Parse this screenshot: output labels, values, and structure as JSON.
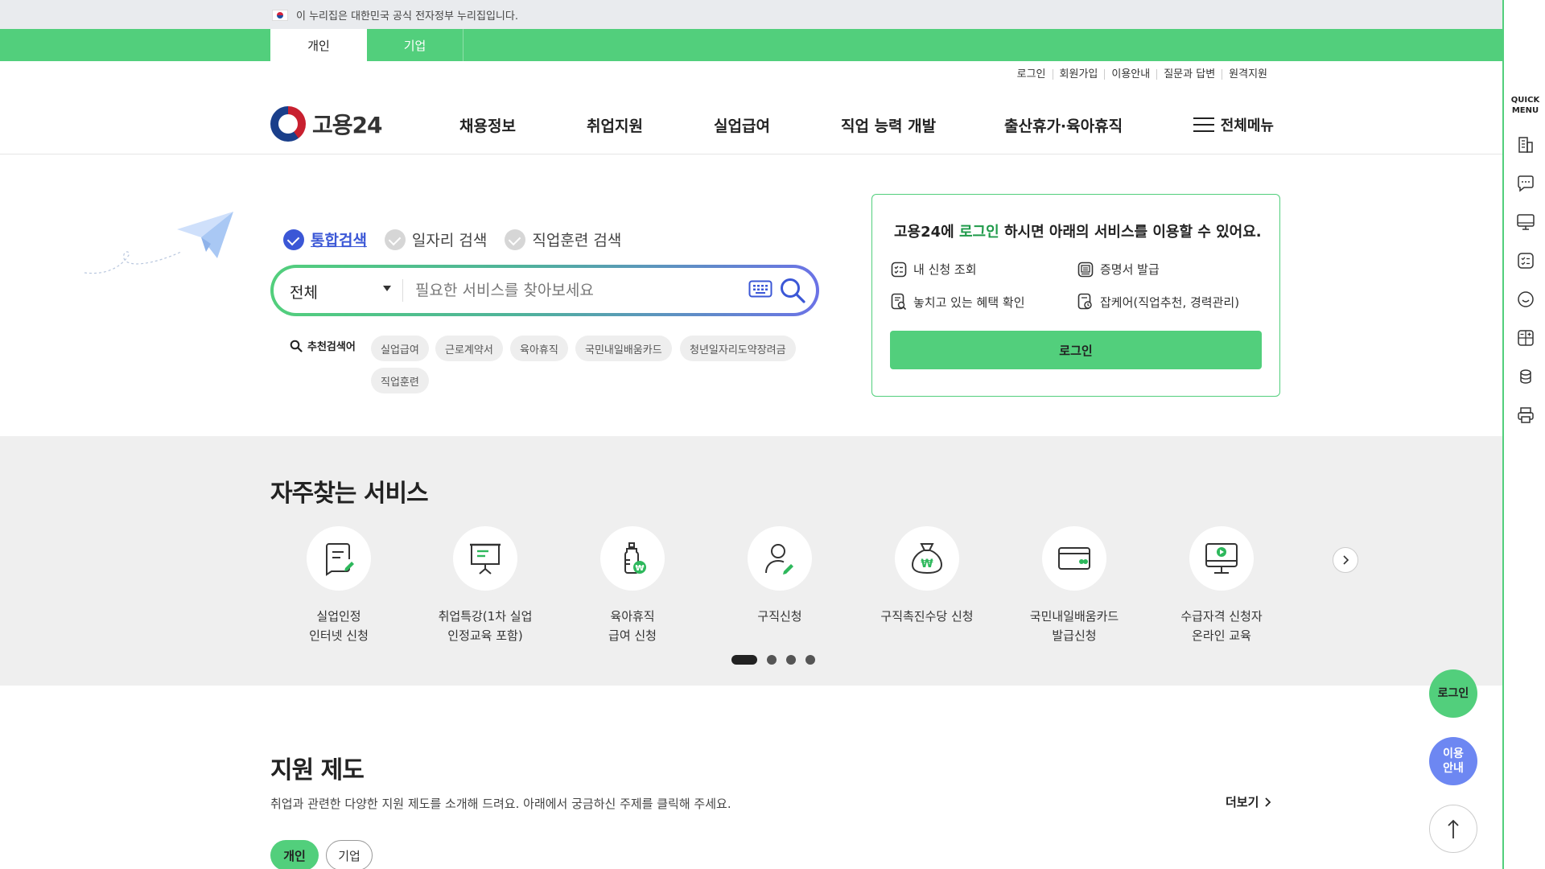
{
  "gov_banner": {
    "text": "이 누리집은 대한민국 공식 전자정부 누리집입니다."
  },
  "audience_tabs": {
    "personal": "개인",
    "business": "기업"
  },
  "util_links": [
    "로그인",
    "회원가입",
    "이용안내",
    "질문과 답변",
    "원격지원"
  ],
  "logo": {
    "text": "고용24"
  },
  "gnb": [
    "채용정보",
    "취업지원",
    "실업급여",
    "직업 능력 개발",
    "출산휴가·육아휴직"
  ],
  "all_menu_label": "전체메뉴",
  "search": {
    "tabs": [
      "통합검색",
      "일자리 검색",
      "직업훈련 검색"
    ],
    "active_tab": "통합검색",
    "scope_value": "전체",
    "placeholder": "필요한 서비스를 찾아보세요",
    "recommend_label": "추천검색어",
    "keywords": [
      "실업급여",
      "근로계약서",
      "육아휴직",
      "국민내일배움카드",
      "청년일자리도약장려금",
      "직업훈련"
    ]
  },
  "login_card": {
    "title_pre": "고용24에 ",
    "title_highlight": "로그인",
    "title_post": " 하시면 아래의 서비스를 이용할 수 있어요.",
    "services": [
      "내 신청 조회",
      "증명서 발급",
      "놓치고 있는 혜택 확인",
      "잡케어(직업추천, 경력관리)"
    ],
    "button": "로그인"
  },
  "frequent": {
    "title": "자주찾는 서비스",
    "items": [
      {
        "label": "실업인정\n인터넷 신청",
        "icon": "document-pen-icon"
      },
      {
        "label": "취업특강(1차 실업\n인정교육 포함)",
        "icon": "presentation-board-icon"
      },
      {
        "label": "육아휴직\n급여 신청",
        "icon": "baby-bottle-icon"
      },
      {
        "label": "구직신청",
        "icon": "person-pen-icon"
      },
      {
        "label": "구직촉진수당 신청",
        "icon": "money-bag-icon"
      },
      {
        "label": "국민내일배움카드\n발급신청",
        "icon": "card-icon"
      },
      {
        "label": "수급자격 신청자\n온라인 교육",
        "icon": "monitor-play-icon"
      }
    ],
    "pages": 4,
    "current_page": 1
  },
  "support": {
    "title": "지원 제도",
    "desc": "취업과 관련한 다양한 지원 제도를 소개해 드려요. 아래에서 궁금하신 주제를 클릭해 주세요.",
    "more": "더보기",
    "tabs": [
      "개인",
      "기업"
    ]
  },
  "quick_menu": {
    "title_line1": "QUICK",
    "title_line2": "MENU",
    "icons": [
      "building-icon",
      "chat-icon",
      "monitor-icon",
      "list-icon",
      "smile-icon",
      "calculator-icon",
      "coin-icon",
      "printer-icon"
    ]
  },
  "floating": {
    "login": "로그인",
    "guide": "이용\n안내"
  },
  "colors": {
    "brand_green": "#52cf7c",
    "accent_blue": "#3b57d6",
    "guide_blue": "#6d87f2"
  }
}
